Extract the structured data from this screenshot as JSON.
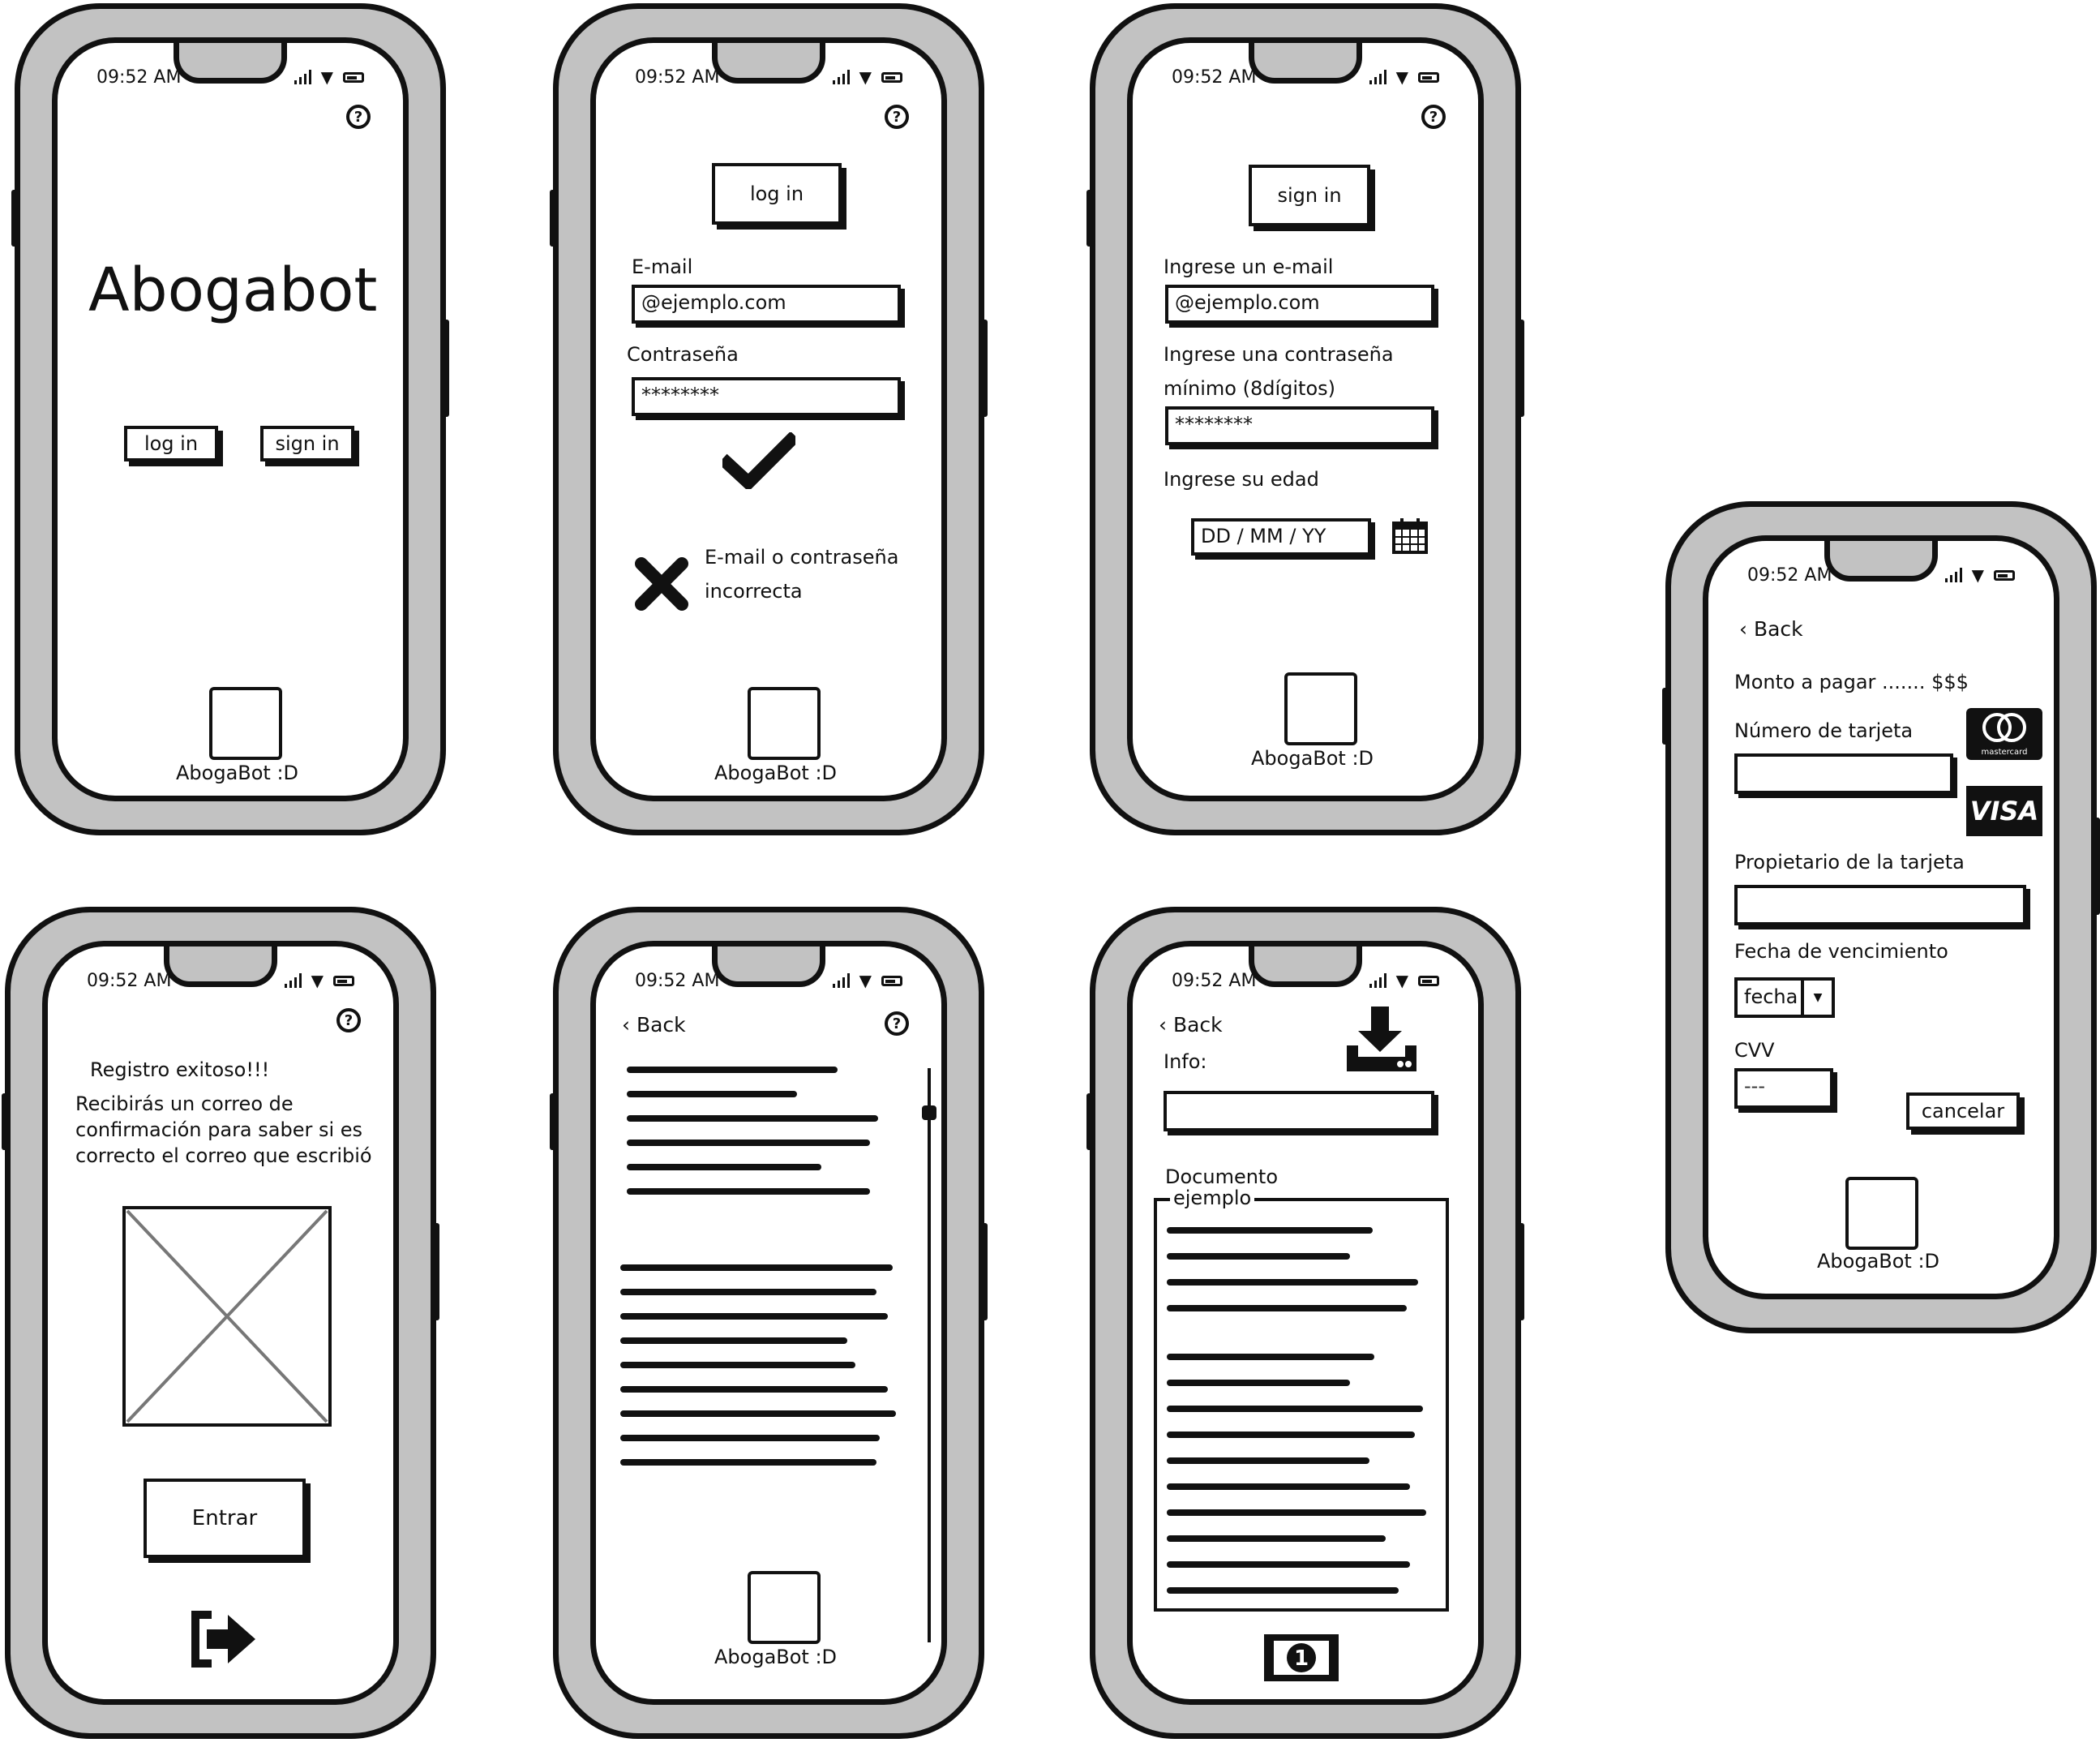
{
  "status": {
    "time": "09:52 AM"
  },
  "bot_label": "AbogaBot :D",
  "screen1": {
    "title": "Abogabot",
    "login": "log in",
    "signin": "sign in"
  },
  "screen2": {
    "login_button": "log in",
    "email_label": "E-mail",
    "email_value": "@ejemplo.com",
    "password_label": "Contraseña",
    "password_value": "********",
    "error_line1": "E-mail o contraseña",
    "error_line2": "incorrecta"
  },
  "screen3": {
    "signin_button": "sign in",
    "email_label": "Ingrese un e-mail",
    "email_value": "@ejemplo.com",
    "password_label": "Ingrese una contraseña",
    "password_hint": "mínimo (8dígitos)",
    "password_value": "********",
    "age_label": "Ingrese su edad",
    "date_placeholder": "DD / MM / YY"
  },
  "screen4": {
    "line1": "Registro exitoso!!!",
    "line2": "Recibirás un correo de",
    "line3": "confirmación para saber si es",
    "line4": "correcto el correo que escribió",
    "enter_button": "Entrar"
  },
  "screen5": {
    "back": "Back"
  },
  "screen6": {
    "back": "Back",
    "info_label": "Info:",
    "doc_label": "Documento",
    "doc_legend": "ejemplo"
  },
  "screen7": {
    "back": "Back",
    "amount": "Monto a pagar ....... $$$",
    "card_number_label": "Número de tarjeta",
    "owner_label": "Propietario de la tarjeta",
    "expiry_label": "Fecha de vencimiento",
    "expiry_select": "fecha",
    "cvv_label": "CVV",
    "cvv_placeholder": "---",
    "cancel_button": "cancelar",
    "mastercard_text": "mastercard",
    "visa_text": "VISA"
  },
  "icons": {
    "help": "help-icon",
    "check": "check-icon",
    "error": "x-icon",
    "calendar": "calendar-icon",
    "back": "chevron-left-icon",
    "download": "download-icon",
    "money": "money-icon",
    "logout": "exit-icon"
  },
  "money_digit": "1"
}
